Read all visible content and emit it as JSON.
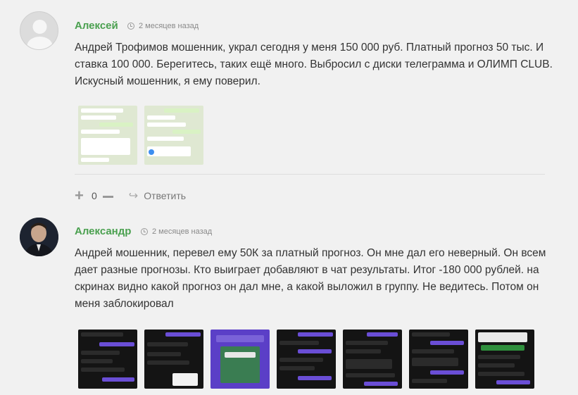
{
  "comments": [
    {
      "author": "Алексей",
      "time": "2 месяцев назад",
      "text": "Андрей Трофимов мошенник, украл сегодня у меня 150 000 руб. Платный прогноз 50 тыс. И ставка 100 000. Берегитесь, таких ещё много. Выбросил с диски телеграмма и ОЛИМП CLUB. Искусный мошенник, я ему поверил.",
      "votes": "0",
      "reply_label": "Ответить",
      "attachments": 2
    },
    {
      "author": "Александр",
      "time": "2 месяцев назад",
      "text": "Андрей мошенник, перевел ему 50К за платный прогноз. Он мне дал его неверный. Он всем дает разные прогнозы. Кто выиграет добавляют в чат результаты. Итог -180 000 рублей. на скринах видно какой прогноз он дал мне, а какой выложил в группу. Не ведитесь. Потом он меня заблокировал",
      "attachments": 7
    }
  ],
  "colors": {
    "author": "#4aa04f",
    "background": "#f1f1f1"
  },
  "icons": {
    "plus": "plus-icon",
    "minus": "minus-icon",
    "reply": "reply-arrow-icon",
    "clock": "clock-icon"
  }
}
